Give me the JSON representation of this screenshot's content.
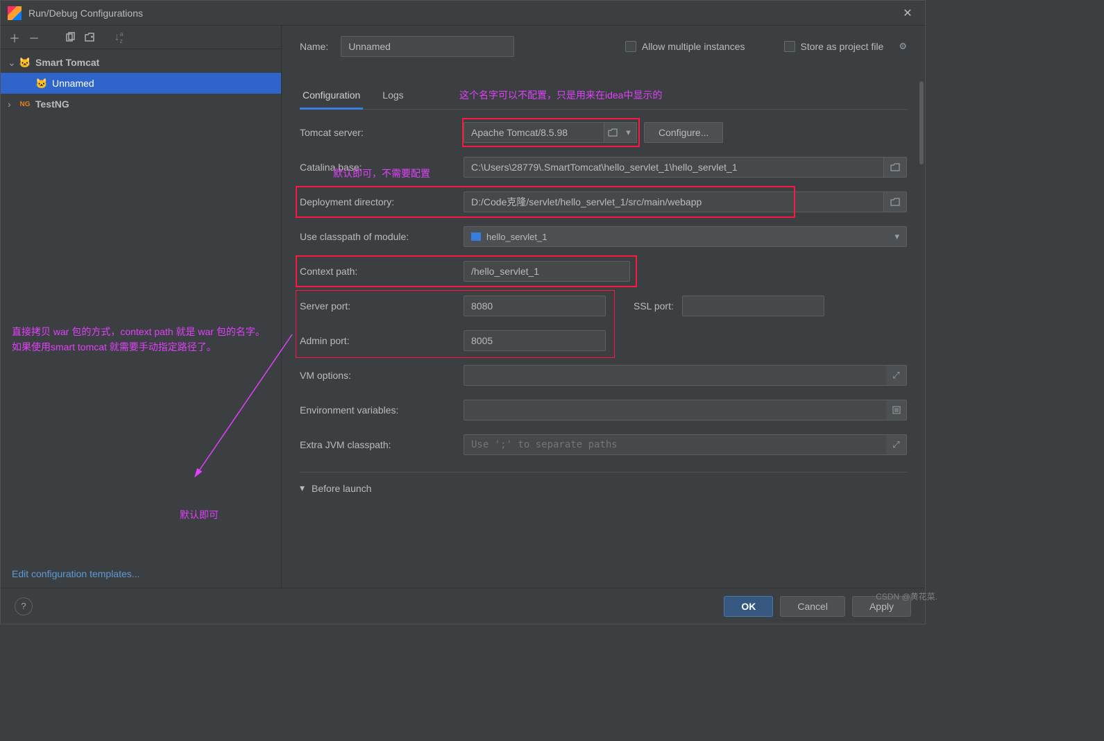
{
  "window": {
    "title": "Run/Debug Configurations"
  },
  "toolbar": {
    "add": "＋",
    "remove": "－",
    "copy": "⿻",
    "save": "📁",
    "sort": "↓ᵃᶻ"
  },
  "tree": {
    "smart_tomcat": "Smart Tomcat",
    "unnamed": "Unnamed",
    "testng": "TestNG"
  },
  "edit_templates": "Edit configuration templates...",
  "header": {
    "name_label": "Name:",
    "name_value": "Unnamed",
    "allow_multiple": "Allow multiple instances",
    "store_project": "Store as project file"
  },
  "tabs": {
    "configuration": "Configuration",
    "logs": "Logs"
  },
  "form": {
    "tomcat_server_label": "Tomcat server:",
    "tomcat_server_value": "Apache Tomcat/8.5.98",
    "configure_btn": "Configure...",
    "catalina_base_label": "Catalina base:",
    "catalina_base_value": "C:\\Users\\28779\\.SmartTomcat\\hello_servlet_1\\hello_servlet_1",
    "deployment_dir_label": "Deployment directory:",
    "deployment_dir_value": "D:/Code克隆/servlet/hello_servlet_1/src/main/webapp",
    "use_classpath_label": "Use classpath of module:",
    "module_value": "hello_servlet_1",
    "context_path_label": "Context path:",
    "context_path_value": "/hello_servlet_1",
    "server_port_label": "Server port:",
    "server_port_value": "8080",
    "ssl_port_label": "SSL port:",
    "ssl_port_value": "",
    "admin_port_label": "Admin port:",
    "admin_port_value": "8005",
    "vm_options_label": "VM options:",
    "vm_options_value": "",
    "env_vars_label": "Environment variables:",
    "env_vars_value": "",
    "extra_jvm_label": "Extra JVM classpath:",
    "extra_jvm_placeholder": "Use ';' to separate paths"
  },
  "before_launch": "Before launch",
  "buttons": {
    "ok": "OK",
    "cancel": "Cancel",
    "apply": "Apply"
  },
  "annotations": {
    "name_note": "这个名字可以不配置，只是用来在idea中显示的",
    "catalina_note": "默认即可，不需要配置",
    "context_note": "直接拷贝 war 包的方式，context path 就是 war 包的名字。如果使用smart tomcat 就需要手动指定路径了。",
    "ports_note": "默认即可"
  },
  "watermark": "CSDN @黄花菜."
}
